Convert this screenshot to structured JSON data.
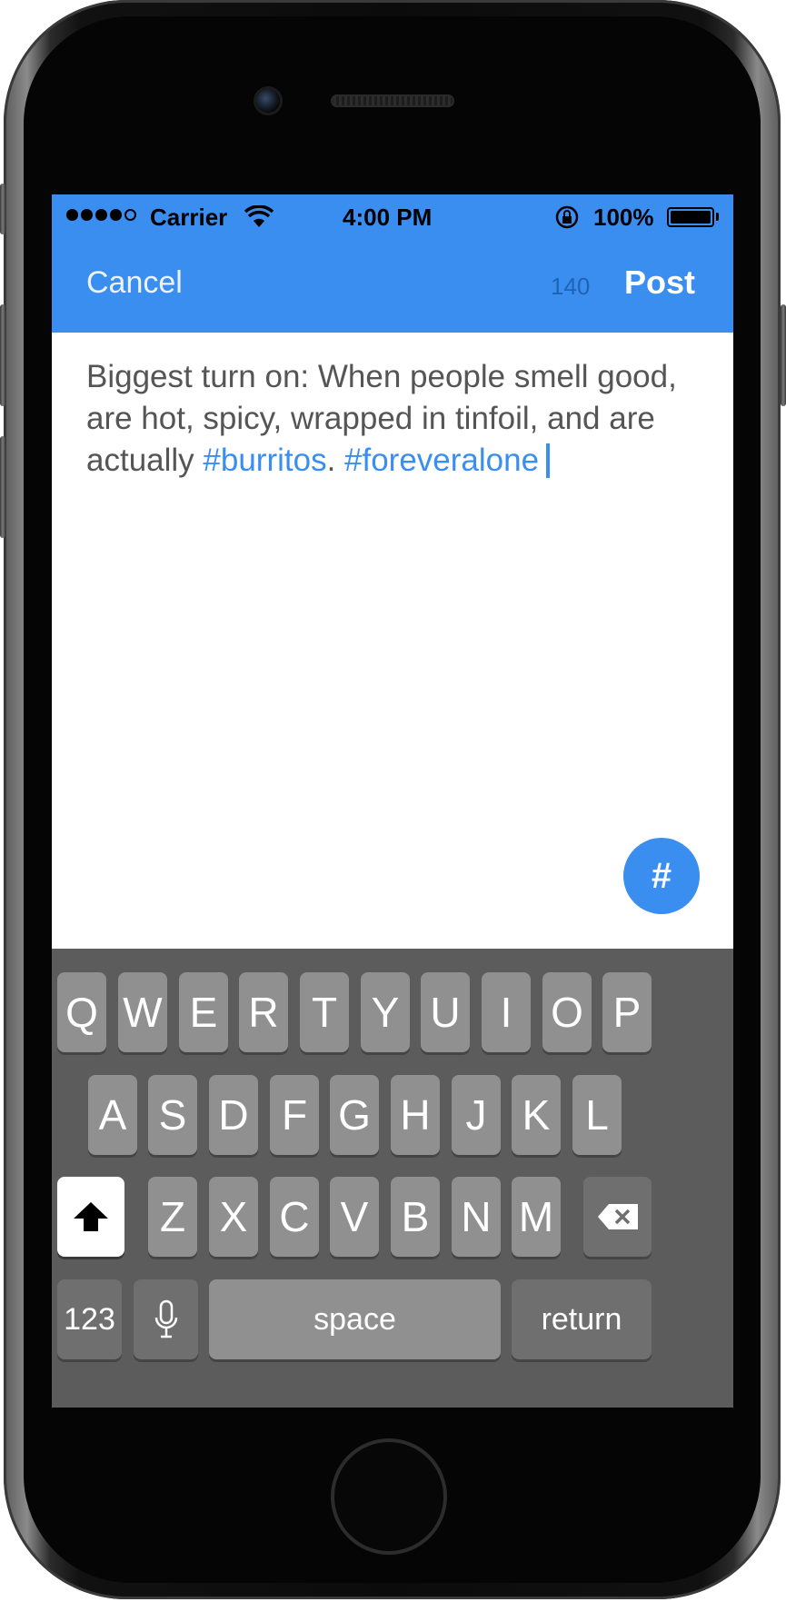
{
  "status_bar": {
    "carrier": "Carrier",
    "time": "4:00 PM",
    "battery": "100%"
  },
  "nav": {
    "cancel": "Cancel",
    "char_count": "140",
    "post": "Post"
  },
  "compose": {
    "text_plain": "Biggest turn on: When people smell good, are hot, spicy, wrapped in tinfoil, and are actually ",
    "hashtag1": "#burritos",
    "sep": ". ",
    "hashtag2": "#foreveralone"
  },
  "hashtag_button": "#",
  "keyboard": {
    "row1": [
      "Q",
      "W",
      "E",
      "R",
      "T",
      "Y",
      "U",
      "I",
      "O",
      "P"
    ],
    "row2": [
      "A",
      "S",
      "D",
      "F",
      "G",
      "H",
      "J",
      "K",
      "L"
    ],
    "row3": [
      "Z",
      "X",
      "C",
      "V",
      "B",
      "N",
      "M"
    ],
    "numbers": "123",
    "space": "space",
    "return": "return"
  },
  "colors": {
    "accent": "#3a8ef0",
    "keyboard_bg": "#5c5c5c",
    "key": "#909090"
  }
}
